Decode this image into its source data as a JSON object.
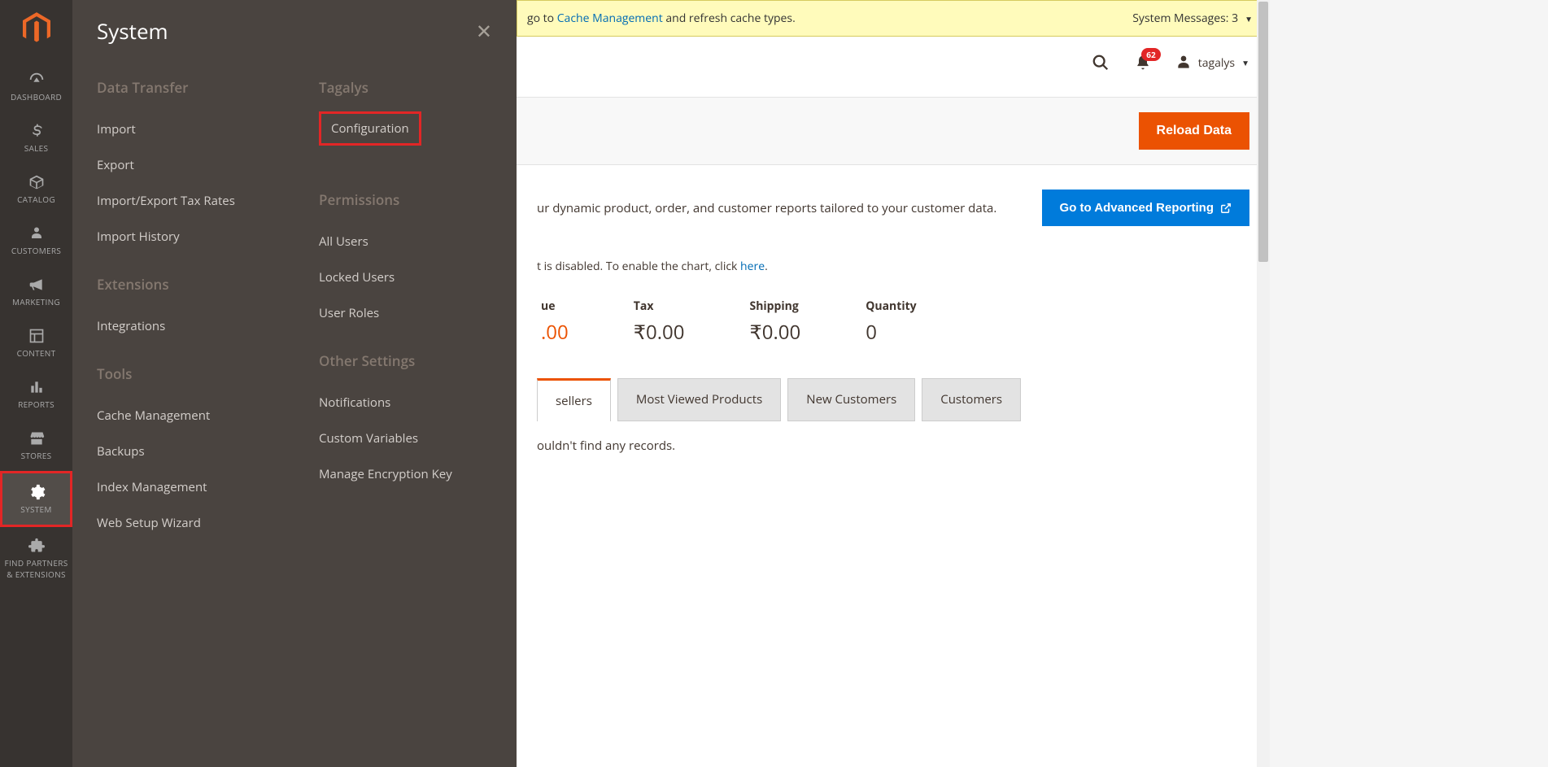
{
  "sidebar": {
    "items": [
      {
        "label": "DASHBOARD",
        "icon": "dashboard"
      },
      {
        "label": "SALES",
        "icon": "dollar"
      },
      {
        "label": "CATALOG",
        "icon": "box"
      },
      {
        "label": "CUSTOMERS",
        "icon": "person"
      },
      {
        "label": "MARKETING",
        "icon": "megaphone"
      },
      {
        "label": "CONTENT",
        "icon": "layout"
      },
      {
        "label": "REPORTS",
        "icon": "bars"
      },
      {
        "label": "STORES",
        "icon": "store"
      },
      {
        "label": "SYSTEM",
        "icon": "gear"
      },
      {
        "label": "FIND PARTNERS & EXTENSIONS",
        "icon": "puzzle"
      }
    ]
  },
  "flyout": {
    "title": "System",
    "col1": {
      "groups": [
        {
          "title": "Data Transfer",
          "items": [
            "Import",
            "Export",
            "Import/Export Tax Rates",
            "Import History"
          ]
        },
        {
          "title": "Extensions",
          "items": [
            "Integrations"
          ]
        },
        {
          "title": "Tools",
          "items": [
            "Cache Management",
            "Backups",
            "Index Management",
            "Web Setup Wizard"
          ]
        }
      ]
    },
    "col2": {
      "groups": [
        {
          "title": "Tagalys",
          "items": [
            "Configuration"
          ]
        },
        {
          "title": "Permissions",
          "items": [
            "All Users",
            "Locked Users",
            "User Roles"
          ]
        },
        {
          "title": "Other Settings",
          "items": [
            "Notifications",
            "Custom Variables",
            "Manage Encryption Key"
          ]
        }
      ]
    }
  },
  "notif": {
    "text_prefix": "go to ",
    "link": "Cache Management",
    "text_suffix": " and refresh cache types.",
    "sys_msg": "System Messages: 3"
  },
  "header": {
    "notif_count": "62",
    "user": "tagalys"
  },
  "buttons": {
    "reload": "Reload Data",
    "adv_report": "Go to Advanced Reporting"
  },
  "content": {
    "adv_text": "ur dynamic product, order, and customer reports tailored to your customer data.",
    "chart_prefix": "t is disabled. To enable the chart, click ",
    "chart_link": "here",
    "chart_suffix": "."
  },
  "stats": [
    {
      "label": "ue",
      "value": ".00",
      "highlight": true,
      "partial": true
    },
    {
      "label": "Tax",
      "value": "₹0.00"
    },
    {
      "label": "Shipping",
      "value": "₹0.00"
    },
    {
      "label": "Quantity",
      "value": "0"
    }
  ],
  "tabs": [
    "sellers",
    "Most Viewed Products",
    "New Customers",
    "Customers"
  ],
  "no_records": "ouldn't find any records."
}
